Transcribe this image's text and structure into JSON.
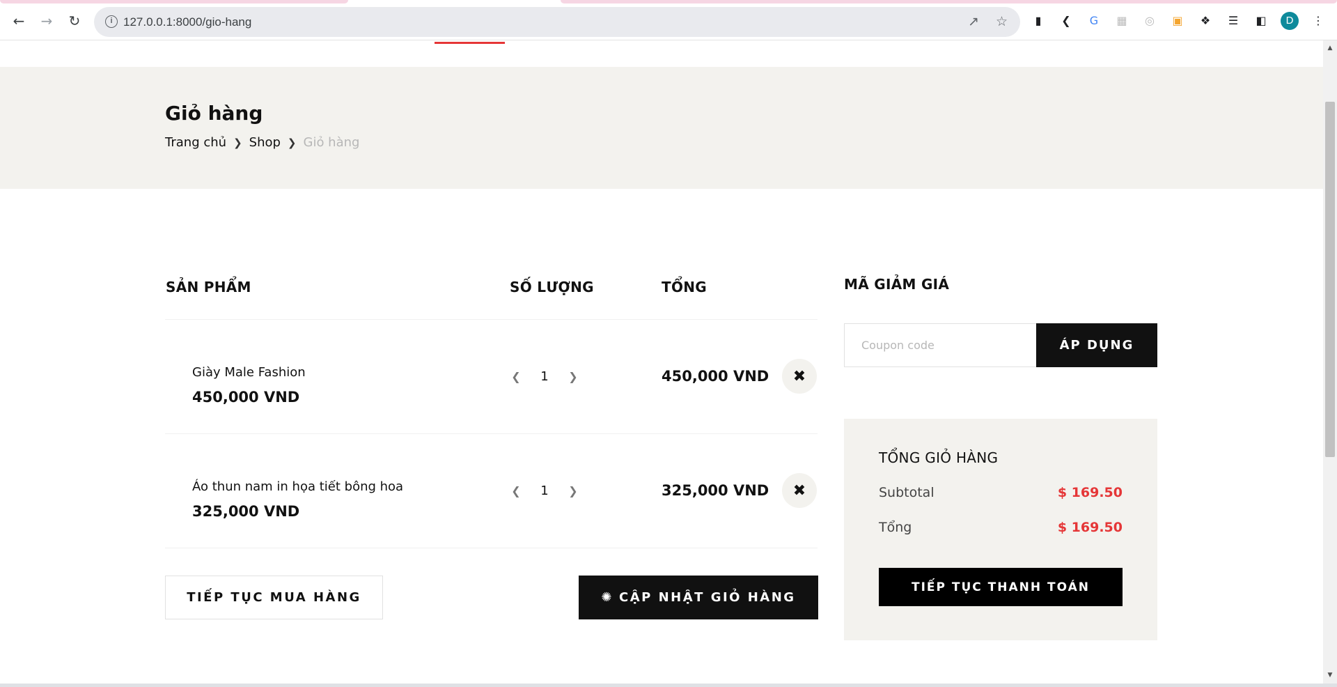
{
  "browser": {
    "url": "127.0.0.1:8000/gio-hang",
    "avatar_letter": "D",
    "tab_accent": "#f6d6e3"
  },
  "header": {
    "title": "Giỏ hàng",
    "breadcrumb": [
      "Trang chủ",
      "Shop",
      "Giỏ hàng"
    ]
  },
  "table": {
    "headers": {
      "product": "SẢN PHẨM",
      "quantity": "SỐ LƯỢNG",
      "total": "TỔNG"
    },
    "rows": [
      {
        "name": "Giày Male Fashion",
        "price": "450,000 VND",
        "quantity": "1",
        "total": "450,000 VND"
      },
      {
        "name": "Áo thun nam in họa tiết bông hoa",
        "price": "325,000 VND",
        "quantity": "1",
        "total": "325,000 VND"
      }
    ]
  },
  "actions": {
    "continue_shopping": "TIẾP TỤC MUA HÀNG",
    "update_cart": "CẬP NHẬT GIỎ HÀNG"
  },
  "coupon": {
    "title": "MÃ GIẢM GIÁ",
    "placeholder": "Coupon code",
    "apply": "ÁP DỤNG"
  },
  "cart_total": {
    "title": "TỔNG GIỎ HÀNG",
    "subtotal_label": "Subtotal",
    "subtotal_value": "$ 169.50",
    "total_label": "Tổng",
    "total_value": "$ 169.50",
    "checkout": "TIẾP TỤC THANH TOÁN"
  },
  "colors": {
    "accent": "#e53637",
    "dark": "#111111",
    "hero_bg": "#f3f2ee"
  }
}
